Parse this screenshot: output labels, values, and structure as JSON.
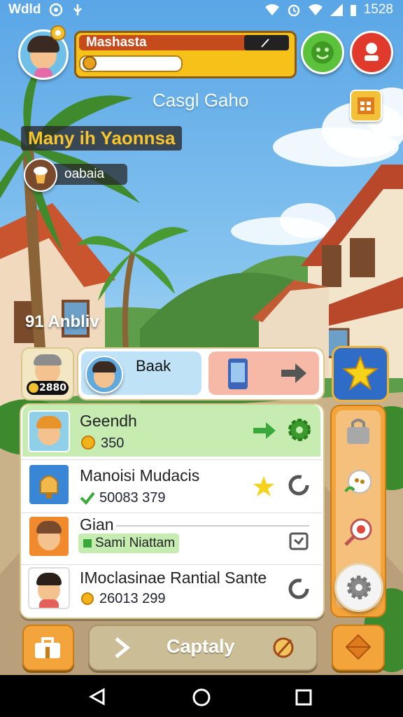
{
  "status_bar": {
    "left_text": "Wdld",
    "time": "1528"
  },
  "player": {
    "name": "Mashasta"
  },
  "title": "Casgl Gaho",
  "banner": {
    "title": "Many ih Yaonnsa",
    "sub_label": "oabaia"
  },
  "location_label": "91 Anbliv",
  "tabs": {
    "left_badge": "2880",
    "active_label": "Baak"
  },
  "list": [
    {
      "title": "Geendh",
      "value": "350"
    },
    {
      "title": "Manoisi Mudacis",
      "value": "50083 379"
    },
    {
      "title": "Gian",
      "tag": "Sami Niattam"
    },
    {
      "title": "IMoclasinae Rantial Sante",
      "value": "26013 299"
    }
  ],
  "bottom": {
    "action_label": "Captaly"
  },
  "colors": {
    "green_accent": "#3aa83a",
    "orange_accent": "#e8a126",
    "red_button": "#d9302a",
    "sky": "#5aa6e6"
  }
}
